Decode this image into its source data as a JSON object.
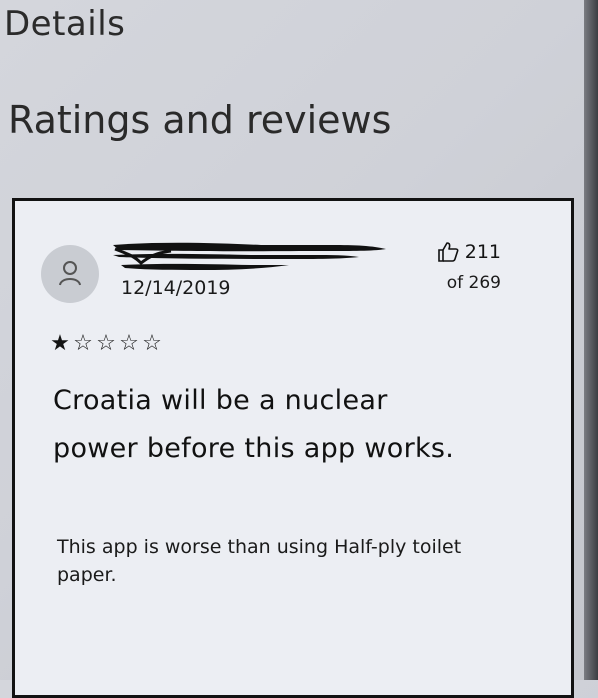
{
  "header": {
    "details_label": "Details",
    "section_title": "Ratings and reviews"
  },
  "review": {
    "date": "12/14/2019",
    "helpful_count": "211",
    "helpful_total": "of 269",
    "rating": 1,
    "rating_max": 5,
    "stars": [
      "★",
      "☆",
      "☆",
      "☆",
      "☆"
    ],
    "title": "Croatia will be a nuclear power before this app works.",
    "body": "This app is worse than using Half-ply toilet paper."
  },
  "icons": {
    "avatar": "person-icon",
    "helpful": "thumbs-up-icon",
    "redaction": "redacted-name-scribble"
  },
  "colors": {
    "background": "#d0d2d8",
    "card": "#eceef3",
    "border": "#121212",
    "avatar": "#c9ccd2"
  }
}
